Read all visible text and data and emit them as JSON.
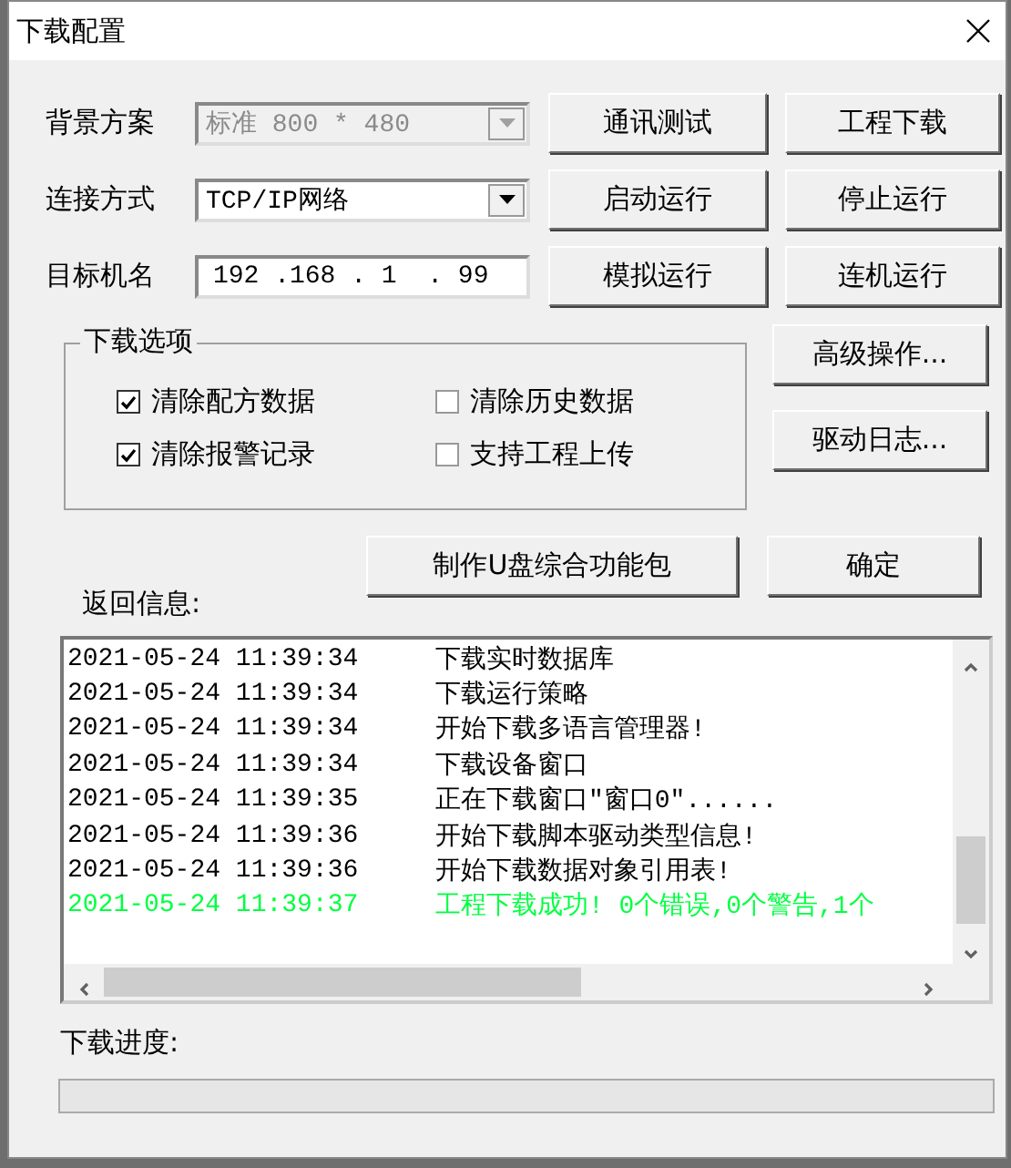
{
  "window": {
    "title": "下载配置"
  },
  "fields": [
    {
      "label": "背景方案",
      "kind": "dropdown",
      "value": "标准 800 * 480",
      "disabled": true
    },
    {
      "label": "连接方式",
      "kind": "dropdown",
      "value": "TCP/IP网络",
      "disabled": false
    },
    {
      "label": "目标机名",
      "kind": "ip",
      "value": "192 .168 . 1  . 99",
      "disabled": false
    }
  ],
  "buttons": [
    [
      "通讯测试",
      "工程下载"
    ],
    [
      "启动运行",
      "停止运行"
    ],
    [
      "模拟运行",
      "连机运行"
    ]
  ],
  "download_options": {
    "title": "下载选项",
    "options": [
      {
        "label": "清除配方数据",
        "checked": true
      },
      {
        "label": "清除历史数据",
        "checked": false
      },
      {
        "label": "清除报警记录",
        "checked": true
      },
      {
        "label": "支持工程上传",
        "checked": false
      }
    ]
  },
  "side_buttons": [
    "高级操作...",
    "驱动日志..."
  ],
  "return_info_label": "返回信息:",
  "usb_button": "制作U盘综合功能包",
  "ok_button": "确定",
  "log": [
    {
      "time": "2021-05-24 11:39:34",
      "message": "下载实时数据库",
      "color": "#000000"
    },
    {
      "time": "2021-05-24 11:39:34",
      "message": "下载运行策略",
      "color": "#000000"
    },
    {
      "time": "2021-05-24 11:39:34",
      "message": "开始下载多语言管理器!",
      "color": "#000000"
    },
    {
      "time": "2021-05-24 11:39:34",
      "message": "下载设备窗口",
      "color": "#000000"
    },
    {
      "time": "2021-05-24 11:39:35",
      "message": "正在下载窗口\"窗口0\"......",
      "color": "#000000"
    },
    {
      "time": "2021-05-24 11:39:36",
      "message": "开始下载脚本驱动类型信息!",
      "color": "#000000"
    },
    {
      "time": "2021-05-24 11:39:36",
      "message": "开始下载数据对象引用表!",
      "color": "#000000"
    },
    {
      "time": "2021-05-24 11:39:37",
      "message": "工程下载成功! 0个错误,0个警告,1个",
      "color": "#00ff40"
    }
  ],
  "progress": {
    "label": "下载进度:",
    "level": 0
  }
}
